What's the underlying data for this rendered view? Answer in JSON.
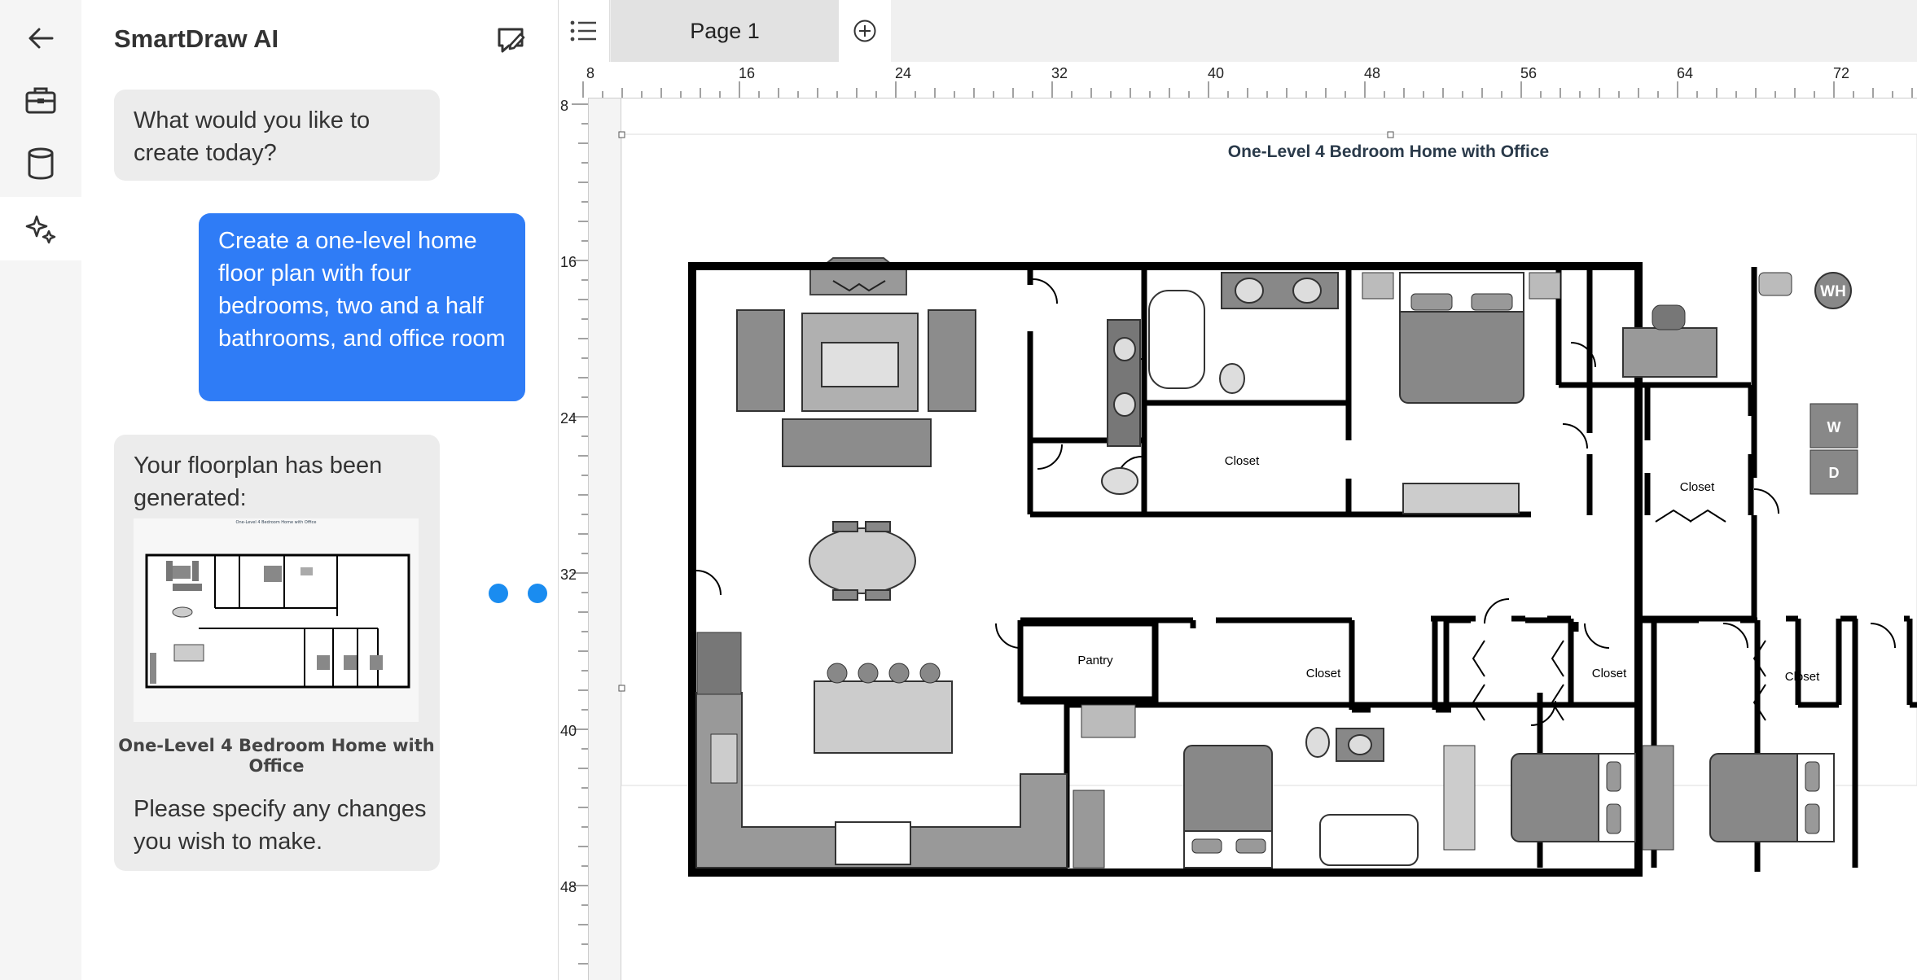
{
  "rail": {
    "items": [
      {
        "icon": "back-arrow-icon"
      },
      {
        "icon": "toolbox-icon"
      },
      {
        "icon": "database-icon"
      },
      {
        "icon": "ai-sparkle-icon",
        "active": true
      }
    ]
  },
  "chat": {
    "title": "SmartDraw AI",
    "messages": [
      {
        "role": "assistant",
        "text": "What would you like to create today?"
      },
      {
        "role": "user",
        "text": "Create a one-level home floor plan with four bedrooms, two and a half bathrooms, and  office room"
      },
      {
        "role": "assistant",
        "text": "Your floorplan has been generated:",
        "thumbnail_caption": "One-Level 4 Bedroom Home with Office",
        "followup": "Please specify any changes you wish to make."
      }
    ]
  },
  "tabs": {
    "pages": [
      "Page 1"
    ]
  },
  "rulers": {
    "horizontal": [
      "8",
      "16",
      "24",
      "32",
      "40",
      "48",
      "56",
      "64",
      "72"
    ],
    "vertical": [
      "8",
      "16",
      "24",
      "32",
      "40",
      "48"
    ]
  },
  "diagram": {
    "title": "One-Level 4 Bedroom Home with Office",
    "room_labels": {
      "closet_master": "Closet",
      "closet_office": "Closet",
      "pantry": "Pantry",
      "closet_bed2": "Closet",
      "closet_bed3": "Closet",
      "closet_bed4": "Closet",
      "water_heater": "WH",
      "washer": "W",
      "dryer": "D"
    }
  },
  "colors": {
    "accent": "#2f7cf6",
    "selection": "#1a8cf0",
    "wall": "#000000",
    "furniture": "#8c8c8c",
    "furniture_light": "#c8c8c8"
  }
}
